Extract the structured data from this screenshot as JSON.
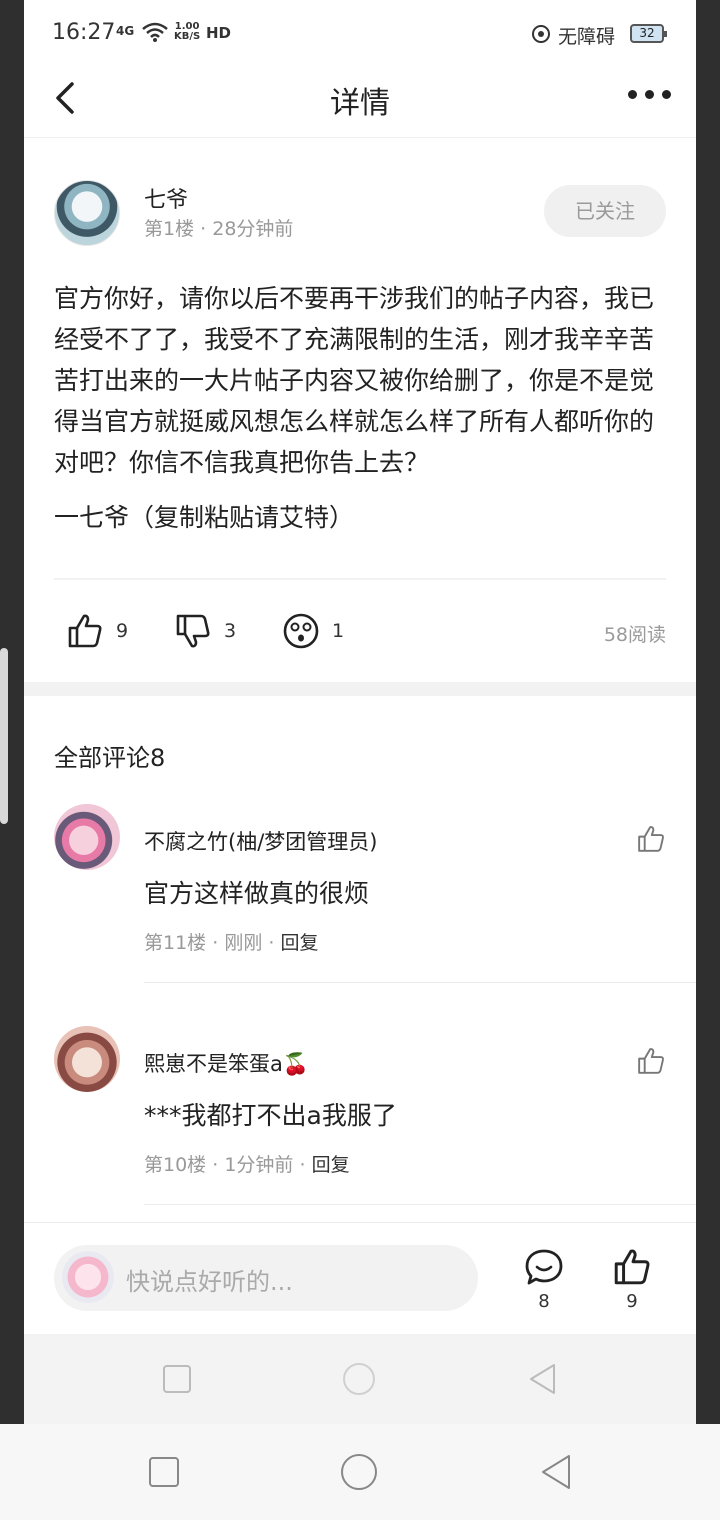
{
  "status": {
    "time": "16:27",
    "signal": "4G",
    "speed_value": "1.00",
    "speed_unit": "KB/S",
    "hd": "HD",
    "accessibility": "无障碍",
    "battery": "32"
  },
  "header": {
    "title": "详情"
  },
  "post": {
    "author": "七爷",
    "floor": "第1楼",
    "time": "28分钟前",
    "follow_label": "已关注",
    "body": "官方你好，请你以后不要再干涉我们的帖子内容，我已经受不了了，我受不了充满限制的生活，刚才我辛辛苦苦打出来的一大片帖子内容又被你给删了，你是不是觉得当官方就挺威风想怎么样就怎么样了所有人都听你的对吧？你信不信我真把你告上去？",
    "signature": "一七爷（复制粘贴请艾特）",
    "likes": "9",
    "dislikes": "3",
    "reactions": "1",
    "reads": "58阅读"
  },
  "comments": {
    "title": "全部评论8",
    "items": [
      {
        "name": "不腐之竹(柚/梦团管理员)",
        "text": "官方这样做真的很烦",
        "floor": "第11楼",
        "time": "刚刚",
        "reply": "回复"
      },
      {
        "name": "熙崽不是笨蛋a🍒",
        "text": "***我都打不出a我服了",
        "floor": "第10楼",
        "time": "1分钟前",
        "reply": "回复"
      }
    ]
  },
  "inputbar": {
    "placeholder": "快说点好听的...",
    "comment_count": "8",
    "like_count": "9"
  },
  "icons": {
    "back": "chevron-left-icon",
    "more": "more-dots-icon",
    "like": "thumbs-up-icon",
    "dislike": "thumbs-down-icon",
    "reaction": "surprised-face-icon",
    "comment": "speech-bubble-icon",
    "nav_square": "recent-apps-icon",
    "nav_circle": "home-icon",
    "nav_triangle": "back-triangle-icon"
  }
}
